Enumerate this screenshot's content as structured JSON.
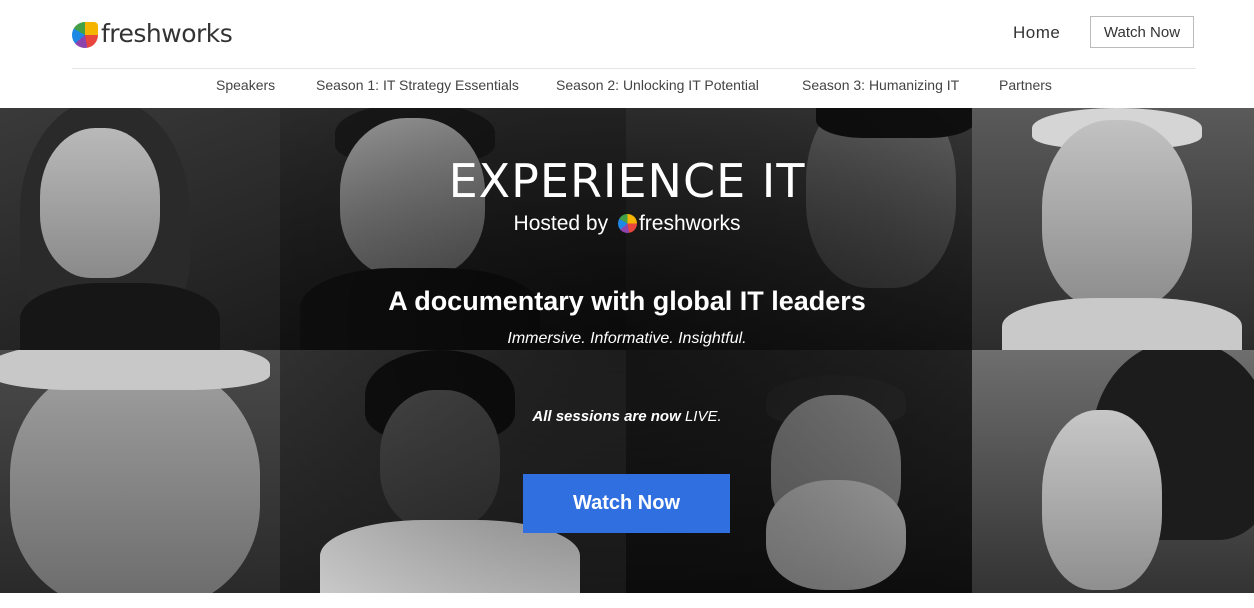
{
  "brand": {
    "name": "freshworks",
    "logo_icon": "freshworks-flower-icon"
  },
  "header": {
    "home_label": "Home",
    "watch_now_label": "Watch Now"
  },
  "subnav": {
    "items": [
      {
        "label": "Speakers"
      },
      {
        "label": "Season 1: IT Strategy Essentials"
      },
      {
        "label": "Season 2: Unlocking IT Potential"
      },
      {
        "label": "Season 3: Humanizing IT"
      },
      {
        "label": "Partners"
      }
    ]
  },
  "hero": {
    "title": "EXPERIENCE IT",
    "hosted_prefix": "Hosted by",
    "hosted_brand": "freshworks",
    "headline": "A documentary with global IT leaders",
    "tagline": "Immersive. Informative. Insightful.",
    "live_note_prefix": "All sessions are now",
    "live_note_word": "LIVE.",
    "cta_label": "Watch Now"
  },
  "colors": {
    "accent_blue": "#2f6fe0",
    "hero_background": "#1a1a1a"
  }
}
